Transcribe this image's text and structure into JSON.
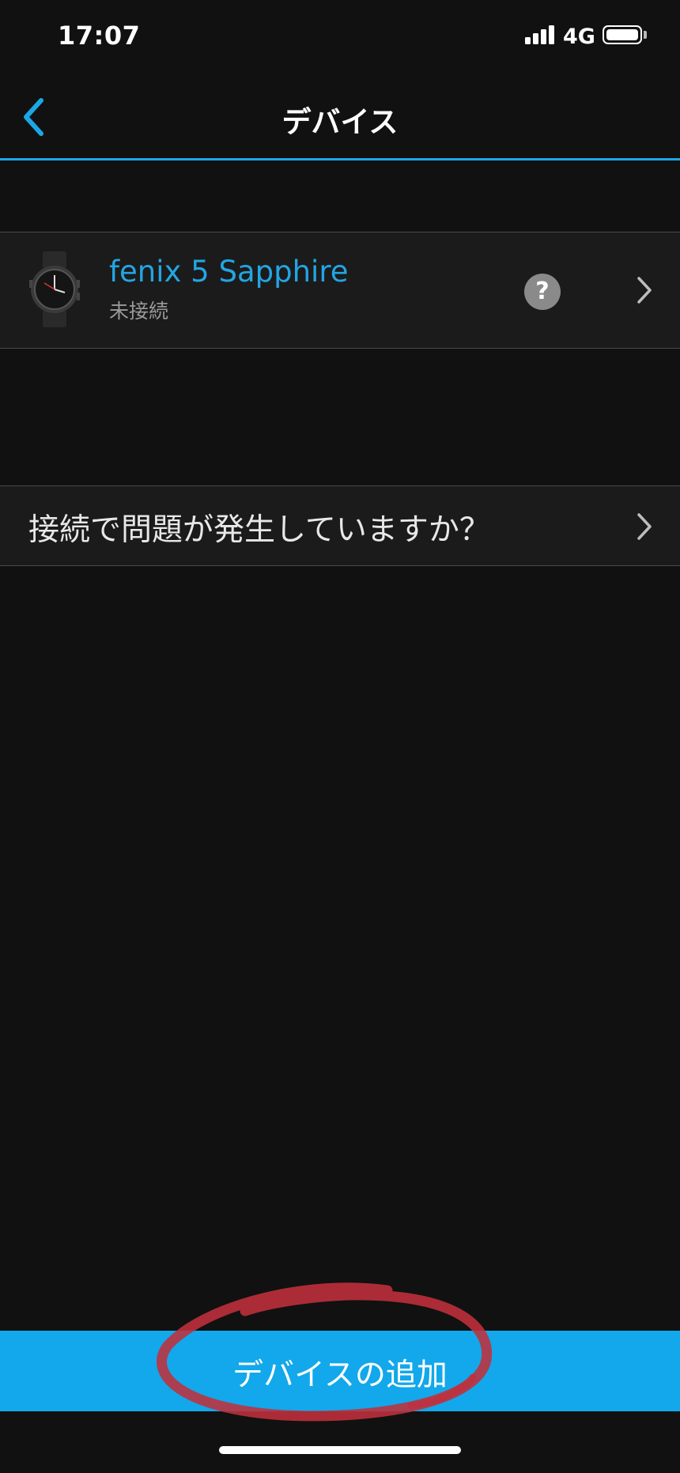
{
  "status_bar": {
    "time": "17:07",
    "network": "4G",
    "icons": [
      "signal-icon",
      "battery-icon"
    ]
  },
  "nav": {
    "title": "デバイス",
    "back_icon": "chevron-left-icon"
  },
  "devices": [
    {
      "name": "fenix 5 Sapphire",
      "status": "未接続",
      "icons": [
        "watch-icon",
        "help-icon",
        "chevron-right-icon"
      ]
    }
  ],
  "help": {
    "symbol": "?"
  },
  "troubleshoot": {
    "label": "接続で問題が発生していますか？",
    "icon": "chevron-right-icon"
  },
  "footer": {
    "add_device_label": "デバイスの追加"
  },
  "colors": {
    "background": "#111111",
    "row_background": "#1b1b1b",
    "accent": "#1ba7e6",
    "button": "#12a8eb",
    "annotation": "#c0303c"
  }
}
